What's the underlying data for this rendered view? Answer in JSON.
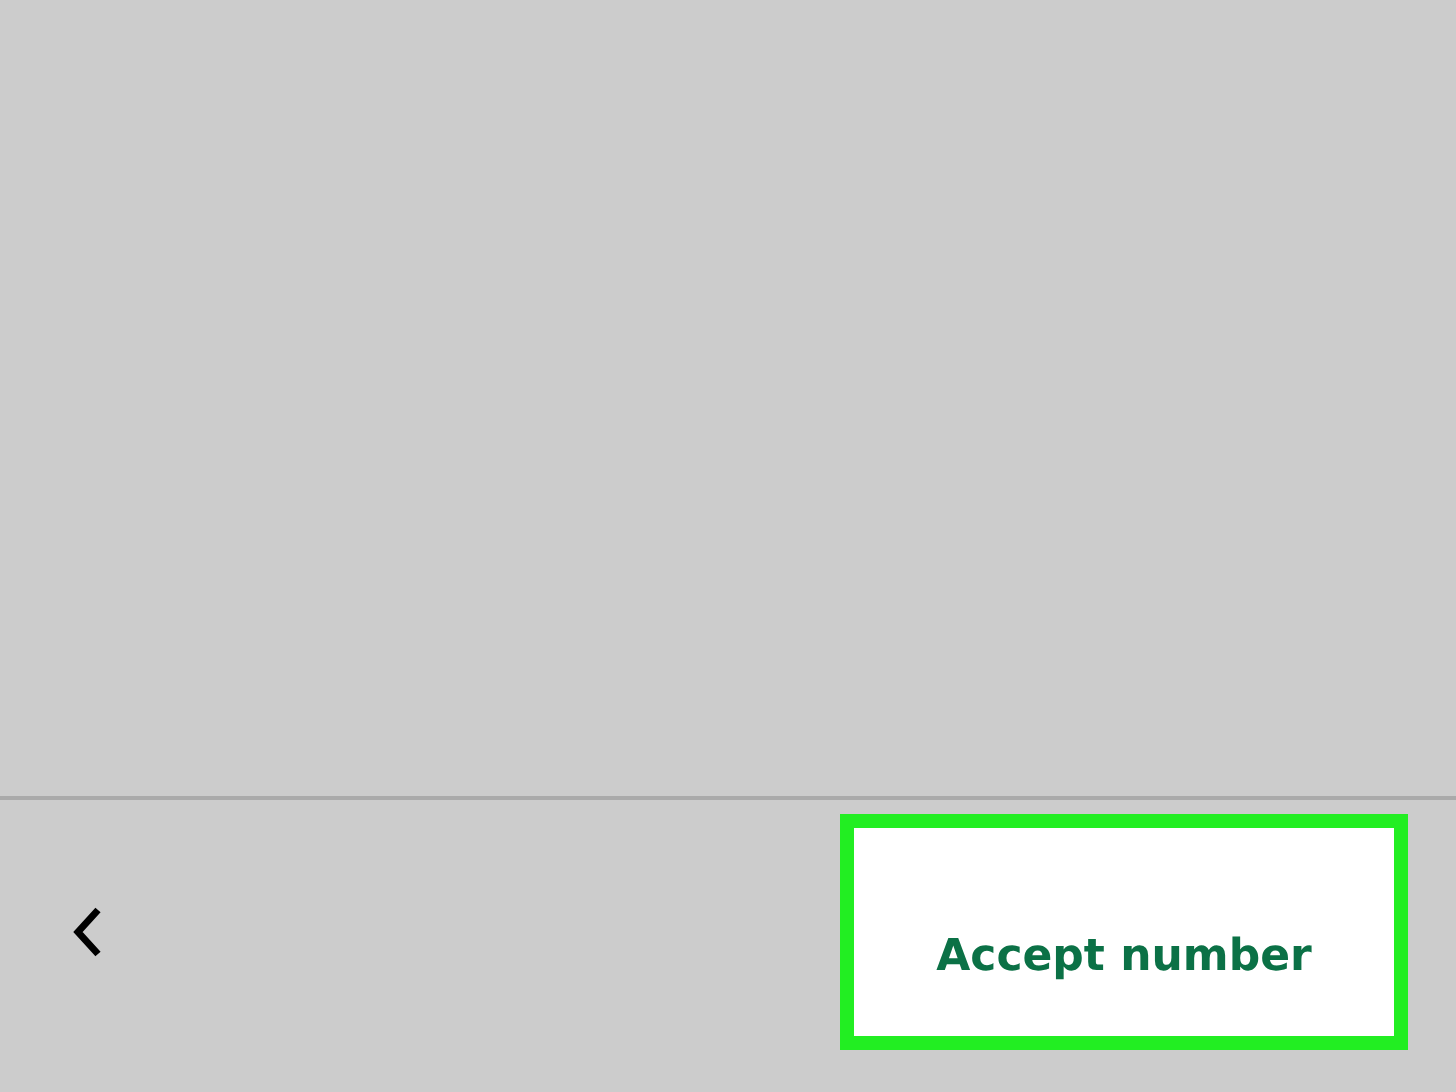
{
  "toolbar": {
    "accept_button": {
      "label": "Accept number",
      "highlighted": true
    }
  }
}
